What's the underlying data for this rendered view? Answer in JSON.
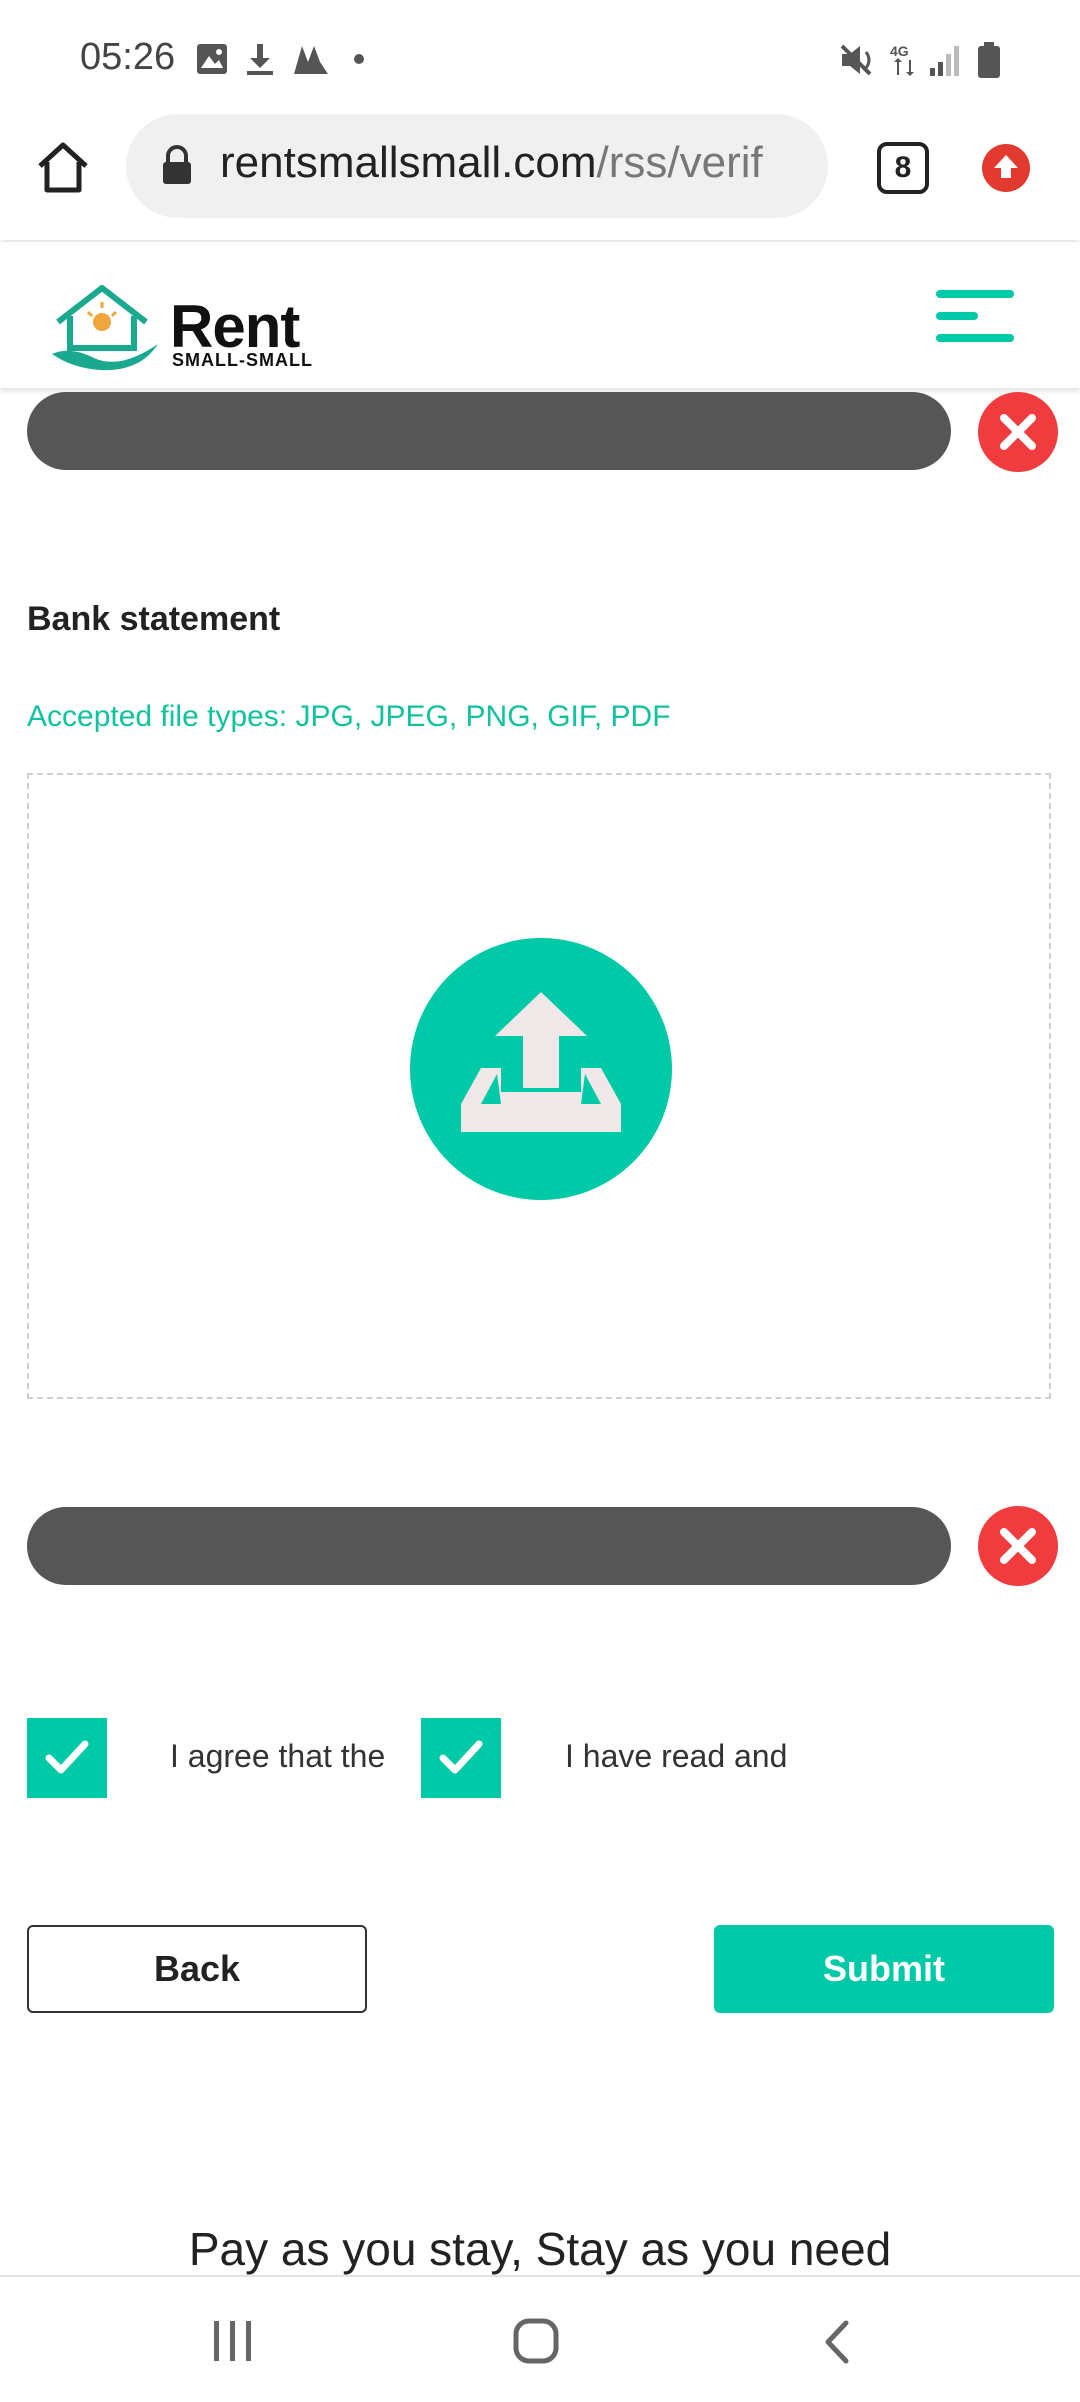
{
  "status_bar": {
    "time": "05:26",
    "icons": [
      "image-icon",
      "download-icon",
      "app-icon",
      "dot-icon",
      "mute-icon",
      "4g-icon",
      "signal-icon",
      "battery-icon"
    ]
  },
  "browser": {
    "url_host": "rentsmallsmall.com",
    "url_path": "/rss/verif",
    "tab_count": "8"
  },
  "site_header": {
    "brand": "Rent",
    "brand_sub": "SMALL-SMALL"
  },
  "form": {
    "bank_statement_label": "Bank statement",
    "accepted_types": "Accepted file types: JPG, JPEG, PNG, GIF, PDF",
    "checkbox_1_text": "I agree that the",
    "checkbox_2_text": "I have read and",
    "back_label": "Back",
    "submit_label": "Submit"
  },
  "footer": {
    "tagline": "Pay as you stay, Stay as you need"
  },
  "colors": {
    "accent": "#00c9a7",
    "danger": "#f03b3f",
    "bar": "#565656"
  }
}
